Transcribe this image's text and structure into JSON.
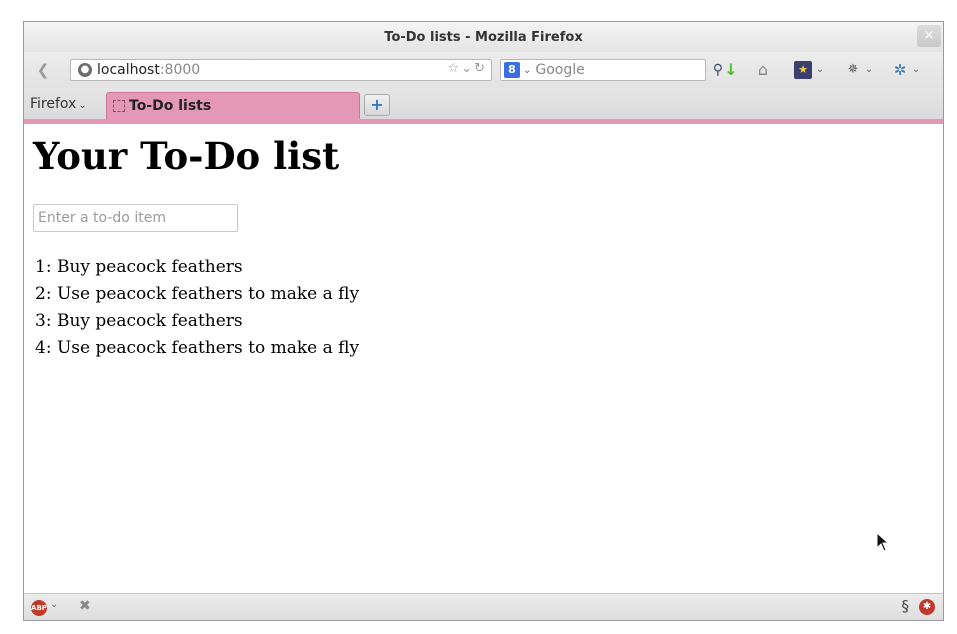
{
  "window": {
    "title": "To-Do lists - Mozilla Firefox",
    "close_glyph": "×"
  },
  "navbar": {
    "url_host": "localhost",
    "url_port": ":8000",
    "search_engine": "Google"
  },
  "tabbar": {
    "menu_label": "Firefox",
    "tab_title": "To-Do lists",
    "new_tab_glyph": "+"
  },
  "page": {
    "heading": "Your To-Do list",
    "input_placeholder": "Enter a to-do item",
    "items": [
      "1: Buy peacock feathers",
      "2: Use peacock feathers to make a fly",
      "3: Buy peacock feathers",
      "4: Use peacock feathers to make a fly"
    ]
  },
  "statusbar": {
    "adblock_label": "ABP"
  },
  "colors": {
    "tab_accent": "#e597b6",
    "download_icon": "#4bbf2a"
  },
  "icons": [
    "back-icon",
    "globe-icon",
    "bookmark-star-icon",
    "google-icon",
    "search-icon",
    "download-icon",
    "home-icon",
    "bookmarks-icon",
    "extension-icon",
    "sync-icon",
    "adblock-icon",
    "close-icon",
    "addon-icon"
  ]
}
